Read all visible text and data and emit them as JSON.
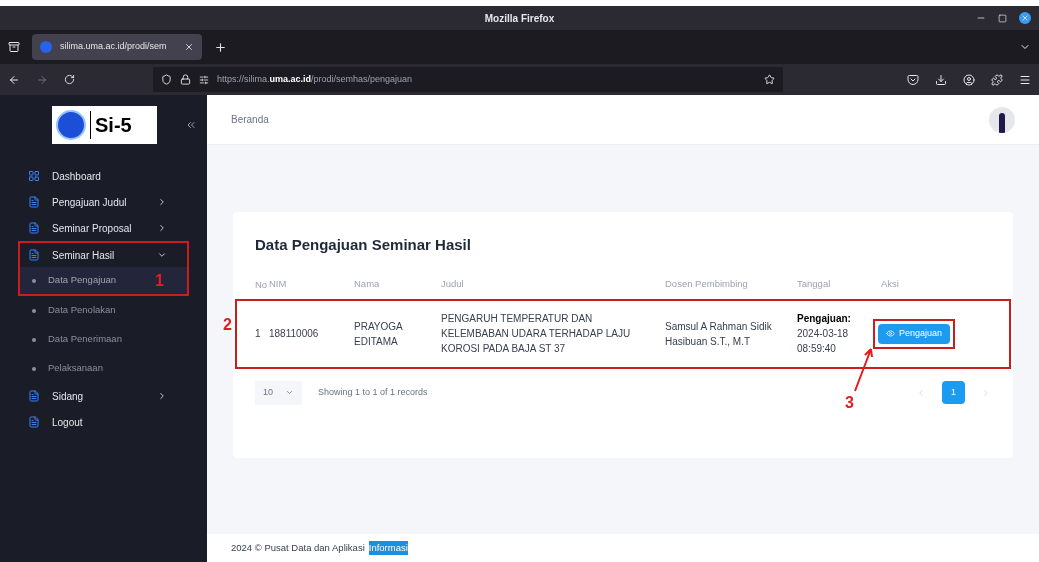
{
  "window": {
    "title": "Mozilla Firefox"
  },
  "tab": {
    "title": "silima.uma.ac.id/prodi/sem"
  },
  "address_bar": {
    "url_prefix": "https://silima.",
    "url_domain": "uma.ac.id",
    "url_path": "/prodi/semhas/pengajuan"
  },
  "sidebar": {
    "logo_text": "Si-5",
    "items": [
      {
        "kind": "group",
        "label": "Dashboard",
        "has_arrow": false,
        "selected": false
      },
      {
        "kind": "group",
        "label": "Pengajuan Judul",
        "has_arrow": true,
        "expanded": false,
        "selected": false
      },
      {
        "kind": "group",
        "label": "Seminar Proposal",
        "has_arrow": true,
        "expanded": false,
        "selected": false
      },
      {
        "kind": "group",
        "label": "Seminar Hasil",
        "has_arrow": true,
        "expanded": true,
        "selected": false,
        "annotated": true
      },
      {
        "kind": "sub",
        "label": "Data Pengajuan",
        "selected": true,
        "annotated": true,
        "annotation": "1"
      },
      {
        "kind": "sub",
        "label": "Data Penolakan",
        "selected": false
      },
      {
        "kind": "sub",
        "label": "Data Penerimaan",
        "selected": false
      },
      {
        "kind": "sub",
        "label": "Pelaksanaan",
        "selected": false
      },
      {
        "kind": "group",
        "label": "Sidang",
        "has_arrow": true,
        "expanded": false,
        "selected": false
      },
      {
        "kind": "group",
        "label": "Logout",
        "has_arrow": false,
        "selected": false
      }
    ]
  },
  "header": {
    "breadcrumb": "Beranda"
  },
  "card": {
    "title": "Data Pengajuan Seminar Hasil",
    "columns": [
      "No",
      "NIM",
      "Nama",
      "Judul",
      "Dosen Pembimbing",
      "Tanggal",
      "Aksi"
    ],
    "rows": [
      {
        "no": "1",
        "nim": "188110006",
        "nama": "PRAYOGA EDITAMA",
        "judul": "PENGARUH TEMPERATUR DAN KELEMBABAN UDARA TERHADAP LAJU KOROSI PADA BAJA ST 37",
        "dosen": "Samsul A Rahman Sidik Hasibuan S.T., M.T",
        "tanggal_label": "Pengajuan:",
        "tanggal": "2024-03-18 08:59:40",
        "action": "Pengajuan",
        "annotation": "2",
        "action_annotation": "3"
      }
    ],
    "page_size": "10",
    "info": "Showing 1 to 1 of 1 records",
    "pages": [
      {
        "label": "1",
        "selected": true
      }
    ]
  },
  "footer": {
    "text": "2024 © Pusat Data dan Aplikasi",
    "highlighted": "Informasi"
  }
}
